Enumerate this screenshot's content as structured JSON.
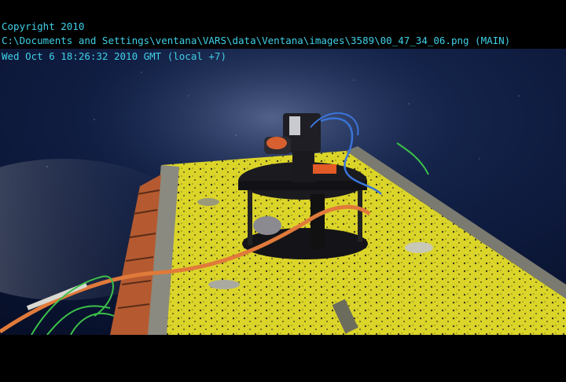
{
  "overlay": {
    "copyright": "Copyright 2010",
    "path": "C:\\Documents and Settings\\ventana\\VARS\\data\\Ventana\\images\\3589\\00_47_34_06.png (MAIN)",
    "timestamp": "Wed Oct 6 18:26:32 2010 GMT (local +7)",
    "text_color": "#3fd0e6"
  },
  "scene": {
    "description_colors": {
      "water": "#0d1a3a",
      "platform": "#e2dc2a",
      "rail": "#7a7a70",
      "cable": "#e07a3a",
      "green_cable": "#3cc04a"
    }
  }
}
